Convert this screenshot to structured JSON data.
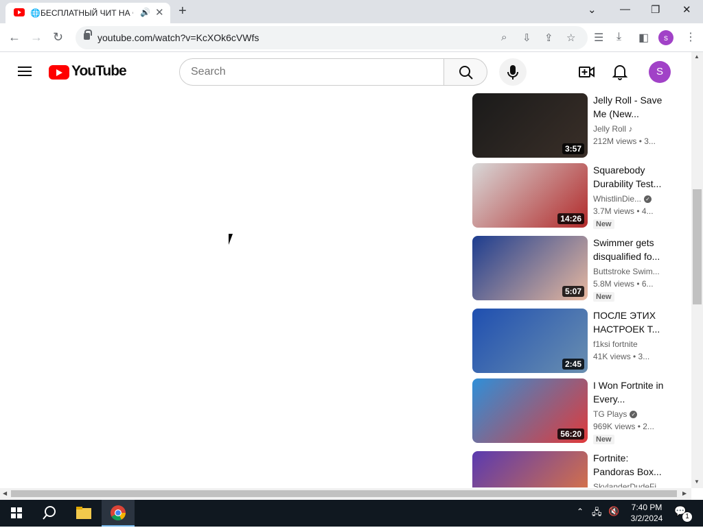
{
  "browser": {
    "tab_title": "🌐БЕСПЛАТНЫЙ ЧИТ НА ФОРТНАЙТ",
    "new_tab": "+",
    "url": "youtube.com/watch?v=KcXOk6cVWfs",
    "profile_initial": "s"
  },
  "youtube": {
    "logo_text": "YouTube",
    "search_placeholder": "Search",
    "avatar_initial": "S"
  },
  "recommendations": [
    {
      "title": "Jelly Roll - Save Me (New...",
      "channel": "Jelly Roll",
      "channel_icon": "music-note-icon",
      "meta": "212M views • 3...",
      "duration": "3:57",
      "badge": "",
      "thumb_colors": [
        "#1a1a1a",
        "#3a2f28"
      ]
    },
    {
      "title": "Squarebody Durability Test...",
      "channel": "WhistlinDie...",
      "channel_icon": "verified-icon",
      "meta": "3.7M views • 4...",
      "duration": "14:26",
      "badge": "New",
      "thumb_colors": [
        "#d8d8d8",
        "#b22a2a"
      ]
    },
    {
      "title": "Swimmer gets disqualified fo...",
      "channel": "Buttstroke Swim...",
      "channel_icon": "",
      "meta": "5.8M views • 6...",
      "duration": "5:07",
      "badge": "New",
      "thumb_colors": [
        "#1d3d8f",
        "#e8b9a0"
      ]
    },
    {
      "title": "ПОСЛЕ ЭТИХ НАСТРОЕК Т...",
      "channel": "f1ksi fortnite",
      "channel_icon": "",
      "meta": "41K views • 3...",
      "duration": "2:45",
      "badge": "",
      "thumb_colors": [
        "#1f4fb0",
        "#6a8fb0"
      ]
    },
    {
      "title": "I Won Fortnite in Every...",
      "channel": "TG Plays",
      "channel_icon": "verified-icon",
      "meta": "969K views • 2...",
      "duration": "56:20",
      "badge": "New",
      "thumb_colors": [
        "#2f8fd8",
        "#e03a3a"
      ]
    },
    {
      "title": "Fortnite: Pandoras Box...",
      "channel": "SkylanderDudeFi...",
      "channel_icon": "",
      "meta": "",
      "duration": "",
      "badge": "",
      "thumb_colors": [
        "#5a3ab0",
        "#e87a3a"
      ]
    }
  ],
  "taskbar": {
    "time": "7:40 PM",
    "date": "3/2/2024",
    "notifications": "1"
  },
  "colors": {
    "brand_red": "#ff0000",
    "avatar_purple": "#a142c7"
  }
}
